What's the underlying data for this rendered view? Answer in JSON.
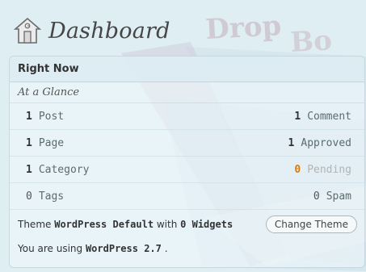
{
  "header": {
    "title": "Dashboard",
    "icon": "home-icon"
  },
  "watermark": {
    "text": "DropBo"
  },
  "right_now": {
    "title": "Right Now",
    "subheading": "At a Glance",
    "rows": [
      {
        "left_num": "1",
        "left_label": "Post",
        "right_num": "1",
        "right_label": "Comment",
        "right_status": "normal"
      },
      {
        "left_num": "1",
        "left_label": "Page",
        "right_num": "1",
        "right_label": "Approved",
        "right_status": "normal"
      },
      {
        "left_num": "1",
        "left_label": "Category",
        "right_num": "0",
        "right_label": "Pending",
        "right_status": "pending"
      },
      {
        "left_num": "0",
        "left_label": "Tags",
        "right_num": "0",
        "right_label": "Spam",
        "right_status": "spam"
      }
    ],
    "theme_prefix": "Theme ",
    "theme_name": "WordPress Default",
    "theme_with": " with ",
    "widgets_count": "0 Widgets",
    "change_theme_label": "Change Theme",
    "version_prefix": "You are using ",
    "version_name": "WordPress 2.7",
    "version_suffix": " ."
  },
  "colors": {
    "pending_count": "#d57a17",
    "panel_bg": "#eef8fb",
    "watermark": "#8a2c48"
  }
}
